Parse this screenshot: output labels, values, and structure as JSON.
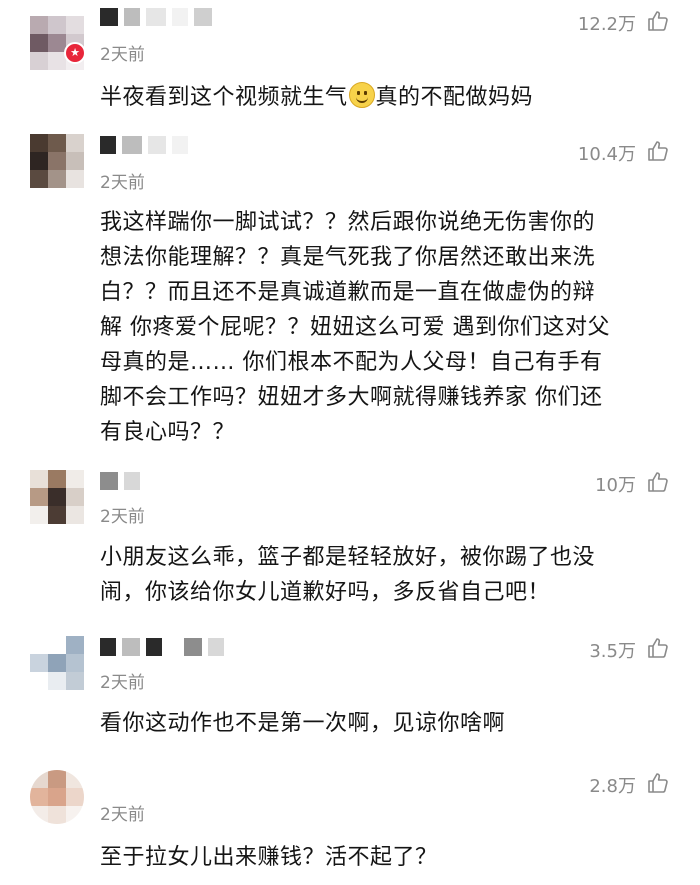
{
  "comments": [
    {
      "time": "2天前",
      "likes": "12.2万",
      "text_parts": [
        "半夜看到这个视频就生气",
        "真的不配做妈妈"
      ],
      "emoji": "slightly-smiling-face-emoji",
      "verified_badge": "★"
    },
    {
      "time": "2天前",
      "likes": "10.4万",
      "lines": [
        "我这样踹你一脚试试？？然后跟你说绝无伤害你的",
        "想法你能理解？？真是气死我了你居然还敢出来洗",
        "白？？而且还不是真诚道歉而是一直在做虚伪的辩",
        "解 你疼爱个屁呢？？妞妞这么可爱 遇到你们这对父",
        "母真的是…… 你们根本不配为人父母！自己有手有",
        "脚不会工作吗？妞妞才多大啊就得赚钱养家 你们还",
        "有良心吗？？"
      ]
    },
    {
      "time": "2天前",
      "likes": "10万",
      "lines": [
        "小朋友这么乖，篮子都是轻轻放好，被你踢了也没",
        "闹，你该给你女儿道歉好吗，多反省自己吧！"
      ]
    },
    {
      "time": "2天前",
      "likes": "3.5万",
      "lines": [
        "看你这动作也不是第一次啊，见谅你啥啊"
      ]
    },
    {
      "time": "2天前",
      "likes": "2.8万",
      "lines": [
        "至于拉女儿出来赚钱？活不起了？"
      ]
    }
  ],
  "icons": {
    "like": "thumbs-up-outline-icon"
  },
  "colors": {
    "secondary_text": "#8a8a8a",
    "badge": "#e8263a"
  }
}
